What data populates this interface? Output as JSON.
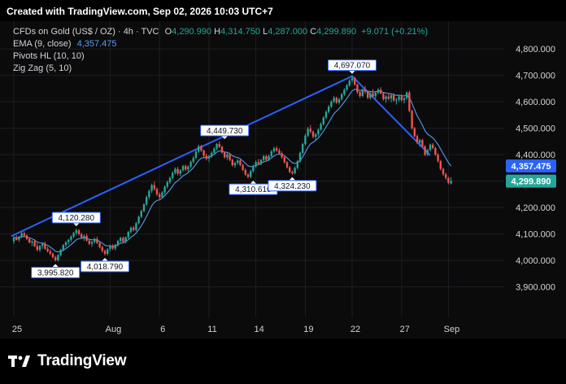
{
  "header": {
    "caption": "Created with TradingView.com, Sep 02, 2026 10:03 UTC+7"
  },
  "legend": {
    "symbol": "CFDs on Gold (US$ / OZ) · 4h · TVC",
    "open_label": "O",
    "open": "4,290.990",
    "high_label": "H",
    "high": "4,314.750",
    "low_label": "L",
    "low": "4,287.000",
    "close_label": "C",
    "close": "4,299.890",
    "change": "+9.071 (+0.21%)",
    "ema_label": "EMA (9, close)",
    "ema_value": "4,357.475",
    "pivots_label": "Pivots HL (10, 10)",
    "zigzag_label": "Zig Zag (5, 10)"
  },
  "brand": {
    "name": "TradingView"
  },
  "colors": {
    "up": "#26a69a",
    "down": "#ef5350",
    "ema": "#5b9cf6",
    "zigzag": "#2962ff",
    "grid": "#1c1f26",
    "axis_text": "#d1d4dc",
    "price_tag": "#26a69a",
    "ema_tag": "#2962ff"
  },
  "chart_data": {
    "type": "candlestick",
    "instrument": "CFDs on Gold (US$ / OZ)",
    "timeframe": "4h",
    "y_ticks": [
      3900,
      4000,
      4100,
      4200,
      4300,
      4400,
      4500,
      4600,
      4700,
      4800
    ],
    "y_tick_labels": [
      "3,900.000",
      "4,000.000",
      "4,100.000",
      "4,200.000",
      "4,300.000",
      "4,400.000",
      "4,500.000",
      "4,600.000",
      "4,700.000",
      "4,800.000"
    ],
    "ylim": [
      3785,
      4905
    ],
    "x_labels": [
      {
        "label": "25",
        "i": 0
      },
      {
        "label": "Aug",
        "i": 37
      },
      {
        "label": "6",
        "i": 56
      },
      {
        "label": "11",
        "i": 75
      },
      {
        "label": "14",
        "i": 93
      },
      {
        "label": "19",
        "i": 112
      },
      {
        "label": "22",
        "i": 130
      },
      {
        "label": "27",
        "i": 149
      },
      {
        "label": "Sep",
        "i": 167
      }
    ],
    "x_count": 180,
    "candles": [
      [
        4072,
        4092,
        4062,
        4087
      ],
      [
        4087,
        4096,
        4075,
        4078
      ],
      [
        4078,
        4093,
        4070,
        4090
      ],
      [
        4090,
        4108,
        4084,
        4103
      ],
      [
        4103,
        4110,
        4090,
        4094
      ],
      [
        4094,
        4099,
        4076,
        4081
      ],
      [
        4081,
        4088,
        4064,
        4068
      ],
      [
        4068,
        4077,
        4055,
        4072
      ],
      [
        4072,
        4080,
        4050,
        4054
      ],
      [
        4054,
        4066,
        4035,
        4040
      ],
      [
        4040,
        4059,
        4032,
        4055
      ],
      [
        4055,
        4068,
        4044,
        4063
      ],
      [
        4063,
        4071,
        4040,
        4044
      ],
      [
        4044,
        4052,
        4030,
        4035
      ],
      [
        4035,
        4042,
        4020,
        4026
      ],
      [
        4026,
        4030,
        4008,
        4012
      ],
      [
        4012,
        4018,
        3996,
        4001
      ],
      [
        4001,
        4024,
        3996,
        4020
      ],
      [
        4020,
        4044,
        4015,
        4040
      ],
      [
        4040,
        4062,
        4034,
        4058
      ],
      [
        4058,
        4073,
        4050,
        4069
      ],
      [
        4069,
        4082,
        4060,
        4078
      ],
      [
        4078,
        4095,
        4070,
        4090
      ],
      [
        4090,
        4108,
        4084,
        4104
      ],
      [
        4104,
        4121,
        4096,
        4114
      ],
      [
        4114,
        4119,
        4095,
        4099
      ],
      [
        4099,
        4105,
        4082,
        4086
      ],
      [
        4086,
        4098,
        4074,
        4093
      ],
      [
        4093,
        4101,
        4071,
        4075
      ],
      [
        4075,
        4082,
        4058,
        4063
      ],
      [
        4063,
        4075,
        4052,
        4070
      ],
      [
        4070,
        4086,
        4064,
        4081
      ],
      [
        4081,
        4090,
        4062,
        4066
      ],
      [
        4066,
        4072,
        4045,
        4050
      ],
      [
        4050,
        4056,
        4030,
        4036
      ],
      [
        4036,
        4041,
        4019,
        4025
      ],
      [
        4025,
        4046,
        4019,
        4043
      ],
      [
        4043,
        4060,
        4035,
        4055
      ],
      [
        4055,
        4061,
        4040,
        4045
      ],
      [
        4045,
        4063,
        4038,
        4059
      ],
      [
        4059,
        4078,
        4052,
        4074
      ],
      [
        4074,
        4090,
        4068,
        4085
      ],
      [
        4085,
        4091,
        4065,
        4070
      ],
      [
        4070,
        4090,
        4064,
        4088
      ],
      [
        4088,
        4112,
        4082,
        4108
      ],
      [
        4108,
        4129,
        4102,
        4124
      ],
      [
        4124,
        4131,
        4110,
        4115
      ],
      [
        4115,
        4146,
        4110,
        4141
      ],
      [
        4141,
        4170,
        4136,
        4165
      ],
      [
        4165,
        4192,
        4160,
        4187
      ],
      [
        4187,
        4217,
        4182,
        4212
      ],
      [
        4212,
        4246,
        4206,
        4240
      ],
      [
        4240,
        4268,
        4232,
        4263
      ],
      [
        4263,
        4291,
        4255,
        4285
      ],
      [
        4285,
        4298,
        4264,
        4270
      ],
      [
        4270,
        4276,
        4244,
        4250
      ],
      [
        4250,
        4258,
        4232,
        4239
      ],
      [
        4239,
        4262,
        4234,
        4257
      ],
      [
        4257,
        4284,
        4250,
        4279
      ],
      [
        4279,
        4302,
        4272,
        4296
      ],
      [
        4296,
        4318,
        4290,
        4312
      ],
      [
        4312,
        4337,
        4306,
        4331
      ],
      [
        4331,
        4352,
        4325,
        4346
      ],
      [
        4346,
        4354,
        4322,
        4328
      ],
      [
        4328,
        4345,
        4318,
        4341
      ],
      [
        4341,
        4362,
        4335,
        4357
      ],
      [
        4357,
        4363,
        4338,
        4344
      ],
      [
        4344,
        4360,
        4331,
        4355
      ],
      [
        4355,
        4378,
        4350,
        4373
      ],
      [
        4373,
        4394,
        4367,
        4388
      ],
      [
        4388,
        4418,
        4382,
        4412
      ],
      [
        4412,
        4438,
        4406,
        4432
      ],
      [
        4432,
        4437,
        4410,
        4416
      ],
      [
        4416,
        4420,
        4390,
        4396
      ],
      [
        4396,
        4404,
        4378,
        4385
      ],
      [
        4385,
        4400,
        4372,
        4395
      ],
      [
        4395,
        4413,
        4388,
        4407
      ],
      [
        4407,
        4429,
        4400,
        4423
      ],
      [
        4423,
        4444,
        4416,
        4440
      ],
      [
        4440,
        4450,
        4425,
        4430
      ],
      [
        4430,
        4434,
        4404,
        4408
      ],
      [
        4408,
        4412,
        4385,
        4390
      ],
      [
        4390,
        4406,
        4380,
        4401
      ],
      [
        4401,
        4407,
        4376,
        4380
      ],
      [
        4380,
        4385,
        4355,
        4360
      ],
      [
        4360,
        4374,
        4350,
        4369
      ],
      [
        4369,
        4384,
        4362,
        4378
      ],
      [
        4378,
        4382,
        4356,
        4361
      ],
      [
        4361,
        4366,
        4338,
        4342
      ],
      [
        4342,
        4348,
        4320,
        4325
      ],
      [
        4325,
        4330,
        4310,
        4316
      ],
      [
        4316,
        4343,
        4311,
        4338
      ],
      [
        4338,
        4362,
        4332,
        4356
      ],
      [
        4356,
        4378,
        4350,
        4372
      ],
      [
        4372,
        4384,
        4360,
        4366
      ],
      [
        4366,
        4384,
        4360,
        4380
      ],
      [
        4380,
        4399,
        4374,
        4394
      ],
      [
        4394,
        4400,
        4375,
        4381
      ],
      [
        4381,
        4400,
        4376,
        4395
      ],
      [
        4395,
        4418,
        4390,
        4412
      ],
      [
        4412,
        4430,
        4406,
        4424
      ],
      [
        4424,
        4432,
        4410,
        4416
      ],
      [
        4416,
        4424,
        4400,
        4405
      ],
      [
        4405,
        4412,
        4384,
        4390
      ],
      [
        4390,
        4394,
        4366,
        4371
      ],
      [
        4371,
        4376,
        4347,
        4352
      ],
      [
        4352,
        4357,
        4330,
        4335
      ],
      [
        4335,
        4340,
        4324,
        4330
      ],
      [
        4330,
        4356,
        4326,
        4350
      ],
      [
        4350,
        4380,
        4344,
        4375
      ],
      [
        4375,
        4412,
        4370,
        4407
      ],
      [
        4407,
        4445,
        4402,
        4440
      ],
      [
        4440,
        4479,
        4434,
        4472
      ],
      [
        4472,
        4505,
        4466,
        4498
      ],
      [
        4498,
        4512,
        4480,
        4487
      ],
      [
        4487,
        4492,
        4462,
        4468
      ],
      [
        4468,
        4482,
        4452,
        4477
      ],
      [
        4477,
        4500,
        4470,
        4495
      ],
      [
        4495,
        4522,
        4490,
        4516
      ],
      [
        4516,
        4546,
        4510,
        4540
      ],
      [
        4540,
        4568,
        4534,
        4562
      ],
      [
        4562,
        4588,
        4556,
        4582
      ],
      [
        4582,
        4606,
        4576,
        4601
      ],
      [
        4601,
        4622,
        4595,
        4615
      ],
      [
        4615,
        4620,
        4592,
        4597
      ],
      [
        4597,
        4615,
        4590,
        4610
      ],
      [
        4610,
        4634,
        4604,
        4628
      ],
      [
        4628,
        4652,
        4622,
        4646
      ],
      [
        4646,
        4668,
        4640,
        4662
      ],
      [
        4662,
        4686,
        4656,
        4680
      ],
      [
        4680,
        4698,
        4672,
        4690
      ],
      [
        4690,
        4694,
        4660,
        4665
      ],
      [
        4665,
        4668,
        4630,
        4636
      ],
      [
        4636,
        4645,
        4615,
        4622
      ],
      [
        4622,
        4650,
        4617,
        4644
      ],
      [
        4644,
        4660,
        4630,
        4638
      ],
      [
        4638,
        4642,
        4610,
        4615
      ],
      [
        4615,
        4638,
        4608,
        4632
      ],
      [
        4632,
        4648,
        4616,
        4621
      ],
      [
        4621,
        4640,
        4612,
        4634
      ],
      [
        4634,
        4652,
        4628,
        4646
      ],
      [
        4646,
        4655,
        4628,
        4632
      ],
      [
        4632,
        4636,
        4604,
        4610
      ],
      [
        4610,
        4626,
        4596,
        4620
      ],
      [
        4620,
        4634,
        4605,
        4612
      ],
      [
        4612,
        4630,
        4598,
        4625
      ],
      [
        4625,
        4632,
        4600,
        4605
      ],
      [
        4605,
        4614,
        4590,
        4608
      ],
      [
        4608,
        4625,
        4600,
        4620
      ],
      [
        4620,
        4629,
        4601,
        4606
      ],
      [
        4606,
        4618,
        4594,
        4614
      ],
      [
        4614,
        4640,
        4608,
        4635
      ],
      [
        4635,
        4642,
        4560,
        4566
      ],
      [
        4566,
        4570,
        4495,
        4500
      ],
      [
        4500,
        4505,
        4465,
        4470
      ],
      [
        4470,
        4476,
        4440,
        4446
      ],
      [
        4446,
        4460,
        4430,
        4455
      ],
      [
        4455,
        4460,
        4425,
        4431
      ],
      [
        4431,
        4436,
        4395,
        4400
      ],
      [
        4400,
        4422,
        4394,
        4418
      ],
      [
        4418,
        4442,
        4412,
        4438
      ],
      [
        4438,
        4444,
        4420,
        4425
      ],
      [
        4425,
        4430,
        4395,
        4400
      ],
      [
        4400,
        4406,
        4370,
        4376
      ],
      [
        4376,
        4380,
        4340,
        4346
      ],
      [
        4346,
        4350,
        4320,
        4326
      ],
      [
        4326,
        4332,
        4305,
        4312
      ],
      [
        4312,
        4316,
        4288,
        4294
      ],
      [
        4291,
        4315,
        4287,
        4300
      ]
    ],
    "ema": {
      "label": "EMA (9, close)",
      "last": 4357.475
    },
    "pivots": [
      {
        "i": 16,
        "price": 3995.82,
        "label": "3,995.820",
        "pos": "below"
      },
      {
        "i": 24,
        "price": 4120.28,
        "label": "4,120.280",
        "pos": "above"
      },
      {
        "i": 35,
        "price": 4018.79,
        "label": "4,018.790",
        "pos": "below"
      },
      {
        "i": 81,
        "price": 4449.73,
        "label": "4,449.730",
        "pos": "above"
      },
      {
        "i": 92,
        "price": 4310.61,
        "label": "4,310.610",
        "pos": "below"
      },
      {
        "i": 107,
        "price": 4324.23,
        "label": "4,324.230",
        "pos": "below"
      },
      {
        "i": 130,
        "price": 4697.07,
        "label": "4,697.070",
        "pos": "above"
      }
    ],
    "zigzag": [
      {
        "i": -1,
        "price": 4092
      },
      {
        "i": 130,
        "price": 4697.07
      },
      {
        "i": 160,
        "price": 4398
      }
    ],
    "price_tags": [
      {
        "value": 4357.475,
        "label": "4,357.475",
        "kind": "ema"
      },
      {
        "value": 4299.89,
        "label": "4,299.890",
        "kind": "last"
      }
    ]
  }
}
